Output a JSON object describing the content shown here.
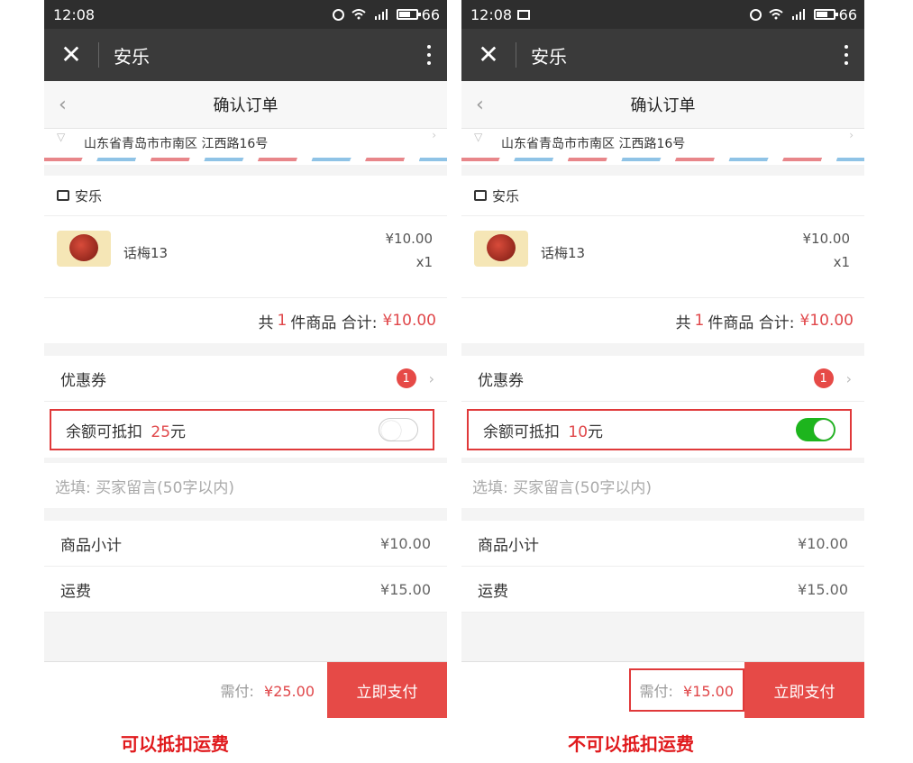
{
  "screens": [
    {
      "status": {
        "time": "12:08",
        "battery": "66"
      },
      "app": {
        "title": "安乐"
      },
      "page": {
        "title": "确认订单"
      },
      "address": "山东省青岛市市南区 江西路16号",
      "store": {
        "name": "安乐"
      },
      "item": {
        "name": "话梅13",
        "price": "¥10.00",
        "qty": "x1"
      },
      "summary": {
        "prefix": "共",
        "count": "1",
        "mid": "件商品 合计:",
        "total": "¥10.00"
      },
      "coupon": {
        "label": "优惠券",
        "badge": "1"
      },
      "balance": {
        "label": "余额可抵扣",
        "amount": "25",
        "unit": "元",
        "enabled": false
      },
      "memo_placeholder": "选填: 买家留言(50字以内)",
      "subtotal": {
        "label": "商品小计",
        "value": "¥10.00"
      },
      "shipping": {
        "label": "运费",
        "value": "¥15.00"
      },
      "pay": {
        "label": "需付:",
        "value": "¥25.00",
        "button": "立即支付"
      }
    },
    {
      "status": {
        "time": "12:08",
        "battery": "66"
      },
      "app": {
        "title": "安乐"
      },
      "page": {
        "title": "确认订单"
      },
      "address": "山东省青岛市市南区 江西路16号",
      "store": {
        "name": "安乐"
      },
      "item": {
        "name": "话梅13",
        "price": "¥10.00",
        "qty": "x1"
      },
      "summary": {
        "prefix": "共",
        "count": "1",
        "mid": "件商品 合计:",
        "total": "¥10.00"
      },
      "coupon": {
        "label": "优惠券",
        "badge": "1"
      },
      "balance": {
        "label": "余额可抵扣",
        "amount": "10",
        "unit": "元",
        "enabled": true
      },
      "memo_placeholder": "选填: 买家留言(50字以内)",
      "subtotal": {
        "label": "商品小计",
        "value": "¥10.00"
      },
      "shipping": {
        "label": "运费",
        "value": "¥15.00"
      },
      "pay": {
        "label": "需付:",
        "value": "¥15.00",
        "button": "立即支付"
      }
    }
  ],
  "captions": {
    "left": "可以抵扣运费",
    "right": "不可以抵扣运费"
  },
  "colors": {
    "accent_red": "#e64a47",
    "toggle_green": "#1db51d",
    "annotation_red": "#e0393a"
  }
}
